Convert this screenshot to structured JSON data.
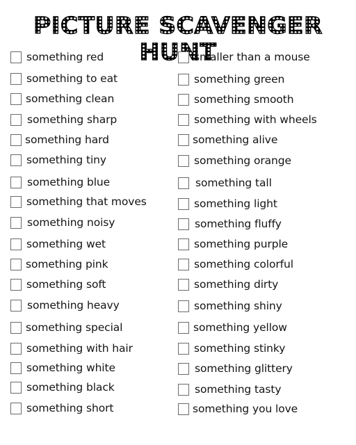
{
  "title": "PICTURE SCAVENGER HUNT",
  "columns": [
    {
      "items": [
        {
          "label": "something red",
          "checked": false
        },
        {
          "label": "something to eat",
          "checked": false
        },
        {
          "label": "something clean",
          "checked": false
        },
        {
          "label": "something sharp",
          "checked": false
        },
        {
          "label": "something hard",
          "checked": false
        },
        {
          "label": "something tiny",
          "checked": false
        },
        {
          "label": "something blue",
          "checked": false
        },
        {
          "label": "something that moves",
          "checked": false
        },
        {
          "label": "something noisy",
          "checked": false
        },
        {
          "label": "something wet",
          "checked": false
        },
        {
          "label": "something pink",
          "checked": false
        },
        {
          "label": "something soft",
          "checked": false
        },
        {
          "label": "something heavy",
          "checked": false
        },
        {
          "label": "something special",
          "checked": false
        },
        {
          "label": "something with hair",
          "checked": false
        },
        {
          "label": "something white",
          "checked": false
        },
        {
          "label": "something black",
          "checked": false
        },
        {
          "label": "something short",
          "checked": false
        }
      ]
    },
    {
      "items": [
        {
          "label": "smaller than a mouse",
          "checked": false
        },
        {
          "label": "something green",
          "checked": false
        },
        {
          "label": "something smooth",
          "checked": false
        },
        {
          "label": "something with wheels",
          "checked": false
        },
        {
          "label": "something alive",
          "checked": false
        },
        {
          "label": "something orange",
          "checked": false
        },
        {
          "label": "something tall",
          "checked": false
        },
        {
          "label": "something light",
          "checked": false
        },
        {
          "label": "something fluffy",
          "checked": false
        },
        {
          "label": "something purple",
          "checked": false
        },
        {
          "label": "something colorful",
          "checked": false
        },
        {
          "label": "something dirty",
          "checked": false
        },
        {
          "label": "something shiny",
          "checked": false
        },
        {
          "label": "something yellow",
          "checked": false
        },
        {
          "label": "something stinky",
          "checked": false
        },
        {
          "label": "something glittery",
          "checked": false
        },
        {
          "label": "something tasty",
          "checked": false
        },
        {
          "label": "something you love",
          "checked": false
        }
      ]
    }
  ]
}
